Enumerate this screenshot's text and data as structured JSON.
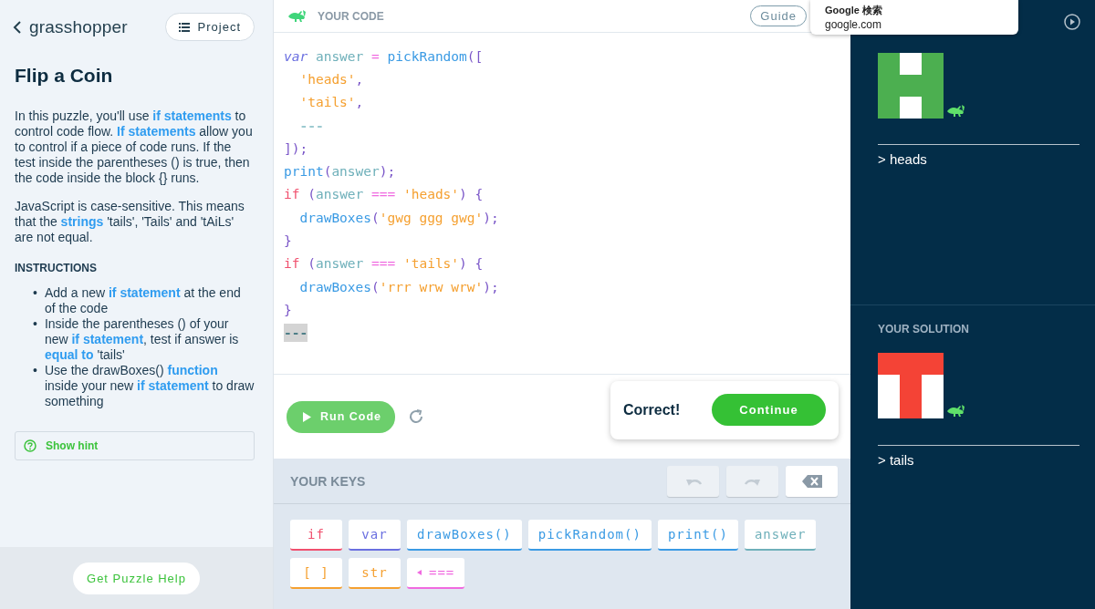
{
  "lesson": {
    "brand": "grasshopper",
    "project_button": "Project",
    "title": "Flip a Coin",
    "paragraphs": [
      "In this puzzle, you'll use **if statements** to control code flow. **If statements** allow you to control if a piece of code runs. If the test inside the parentheses () is true, then the code inside the block {} runs.",
      "JavaScript is case-sensitive. This means that the **strings** 'tails', 'Tails' and 'tAiLs' are not equal."
    ],
    "instructions_heading": "INSTRUCTIONS",
    "instructions": [
      {
        "bullet": "•",
        "text": "Add a new **if statement** at the end of the code"
      },
      {
        "bullet": "•",
        "text": "Inside the parentheses () of your new **if statement**, test if answer is **equal to** 'tails'"
      },
      {
        "bullet": "•",
        "text": "Use the drawBoxes() **function** inside your new **if statement** to draw something"
      }
    ],
    "hint": "Show hint",
    "help_button": "Get Puzzle Help"
  },
  "editor": {
    "heading": "YOUR CODE",
    "guide_button": "Guide",
    "lines": [
      {
        "tokens": [
          {
            "kind": "keyword",
            "text": "var "
          },
          {
            "kind": "variable",
            "text": "answer "
          },
          {
            "kind": "operator",
            "text": "= "
          },
          {
            "kind": "function",
            "text": "pickRandom"
          },
          {
            "kind": "punct",
            "text": "(["
          }
        ]
      },
      {
        "tokens": [
          {
            "kind": "string",
            "text": "  'heads'"
          },
          {
            "kind": "punct",
            "text": ","
          }
        ]
      },
      {
        "tokens": [
          {
            "kind": "string",
            "text": "  'tails'"
          },
          {
            "kind": "punct",
            "text": ","
          }
        ]
      },
      {
        "tokens": [
          {
            "kind": "blank",
            "text": "  ---",
            "selected": false
          }
        ]
      },
      {
        "tokens": [
          {
            "kind": "punct",
            "text": "]);"
          }
        ]
      },
      {
        "tokens": [
          {
            "kind": "function",
            "text": "print"
          },
          {
            "kind": "punct",
            "text": "("
          },
          {
            "kind": "variable",
            "text": "answer"
          },
          {
            "kind": "punct",
            "text": ");"
          }
        ]
      },
      {
        "tokens": [
          {
            "kind": "control",
            "text": "if "
          },
          {
            "kind": "punct",
            "text": "("
          },
          {
            "kind": "variable",
            "text": "answer "
          },
          {
            "kind": "operator",
            "text": "=== "
          },
          {
            "kind": "string",
            "text": "'heads'"
          },
          {
            "kind": "punct",
            "text": ") {"
          }
        ]
      },
      {
        "tokens": [
          {
            "kind": "function",
            "text": "  drawBoxes"
          },
          {
            "kind": "punct",
            "text": "("
          },
          {
            "kind": "string",
            "text": "'gwg ggg gwg'"
          },
          {
            "kind": "punct",
            "text": ");"
          }
        ]
      },
      {
        "tokens": [
          {
            "kind": "punct",
            "text": "}"
          }
        ]
      },
      {
        "tokens": [
          {
            "kind": "control",
            "text": "if "
          },
          {
            "kind": "punct",
            "text": "("
          },
          {
            "kind": "variable",
            "text": "answer "
          },
          {
            "kind": "operator",
            "text": "=== "
          },
          {
            "kind": "string",
            "text": "'tails'"
          },
          {
            "kind": "punct",
            "text": ") {"
          }
        ]
      },
      {
        "tokens": [
          {
            "kind": "function",
            "text": "  drawBoxes"
          },
          {
            "kind": "punct",
            "text": "("
          },
          {
            "kind": "string",
            "text": "'rrr wrw wrw'"
          },
          {
            "kind": "punct",
            "text": ");"
          }
        ]
      },
      {
        "tokens": [
          {
            "kind": "punct",
            "text": "}"
          }
        ]
      },
      {
        "tokens": [
          {
            "kind": "blank",
            "text": "---",
            "selected": true
          }
        ]
      }
    ],
    "run_button": "Run Code",
    "result": "Correct!",
    "continue_button": "Continue",
    "keys_heading": "YOUR KEYS",
    "edit_buttons": [
      {
        "kind": "undo",
        "disabled": true
      },
      {
        "kind": "redo",
        "disabled": true
      },
      {
        "kind": "delete",
        "disabled": false
      }
    ],
    "keys": [
      {
        "kind": "control",
        "text": "if"
      },
      {
        "kind": "keyword",
        "text": "var"
      },
      {
        "kind": "function",
        "text": "drawBoxes()"
      },
      {
        "kind": "function",
        "text": "pickRandom()"
      },
      {
        "kind": "function",
        "text": "print()"
      },
      {
        "kind": "variable",
        "text": "answer"
      },
      {
        "kind": "string",
        "text": "[ ]"
      },
      {
        "kind": "string",
        "text": "str"
      },
      {
        "kind": "operator",
        "text": "===",
        "expand": true
      }
    ]
  },
  "output": {
    "panels": [
      {
        "boxes": [
          {
            "color": "#4caf50"
          },
          {
            "color": "#ffffff"
          },
          {
            "color": "#4caf50"
          },
          {
            "color": "#4caf50"
          },
          {
            "color": "#4caf50"
          },
          {
            "color": "#4caf50"
          },
          {
            "color": "#4caf50"
          },
          {
            "color": "#ffffff"
          },
          {
            "color": "#4caf50"
          }
        ],
        "console": "> heads"
      },
      {
        "heading": "YOUR SOLUTION",
        "boxes": [
          {
            "color": "#f44336"
          },
          {
            "color": "#f44336"
          },
          {
            "color": "#f44336"
          },
          {
            "color": "#ffffff"
          },
          {
            "color": "#f44336"
          },
          {
            "color": "#ffffff"
          },
          {
            "color": "#ffffff"
          },
          {
            "color": "#f44336"
          },
          {
            "color": "#ffffff"
          }
        ],
        "console": "> tails"
      }
    ]
  },
  "tooltip": {
    "title": "Google 検索",
    "url": "google.com"
  }
}
